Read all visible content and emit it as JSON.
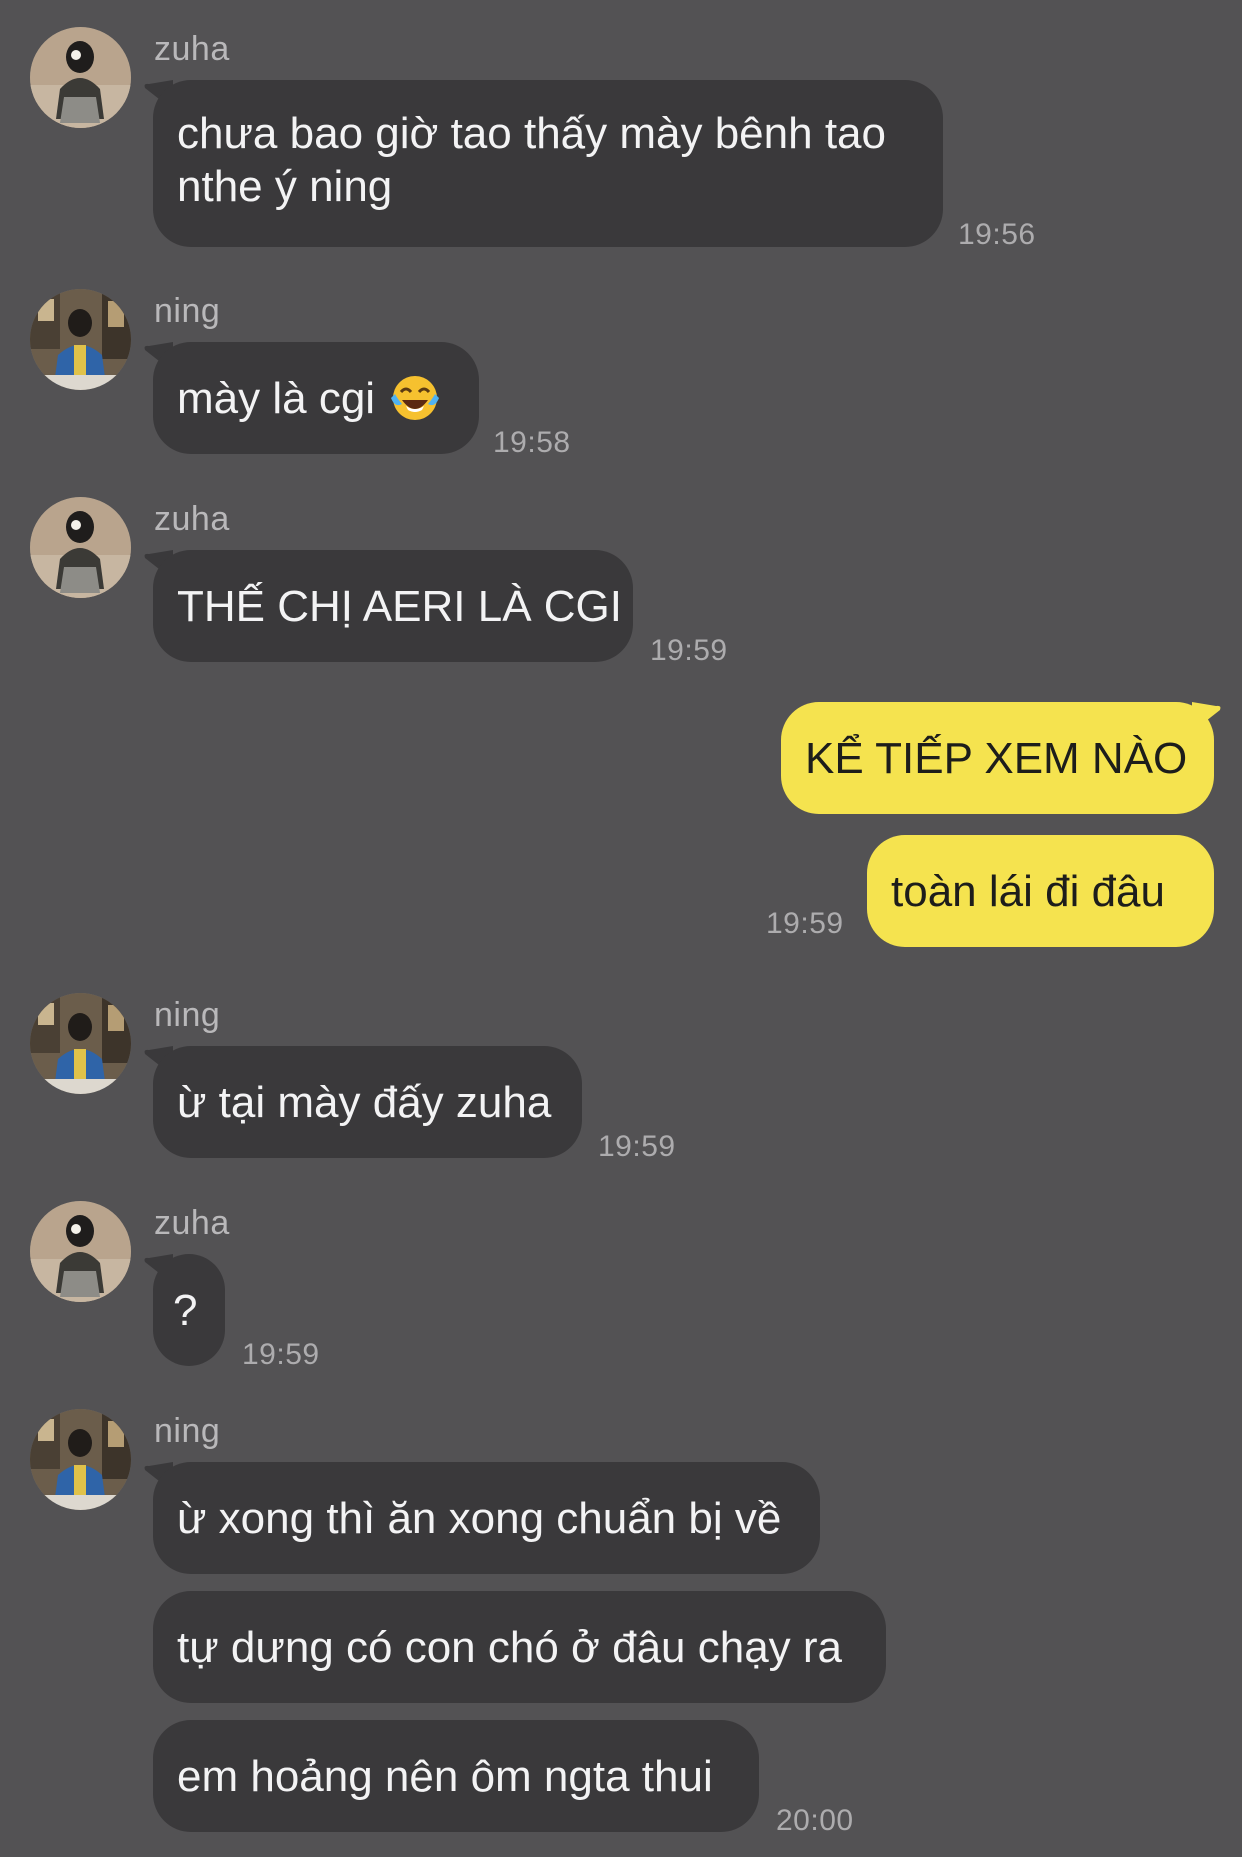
{
  "messages": [
    {
      "sender": "zuha",
      "text": "chưa bao giờ tao thấy mày bênh tao nthe ý ning",
      "time": "19:56"
    },
    {
      "sender": "ning",
      "text": "mày là cgi",
      "emoji": "face-with-tears-of-joy",
      "time": "19:58"
    },
    {
      "sender": "zuha",
      "text": "THẾ CHỊ AERI LÀ CGI",
      "time": "19:59"
    },
    {
      "sender": "me",
      "text": "KỂ TIẾP XEM NÀO"
    },
    {
      "sender": "me",
      "text": "toàn lái đi đâu",
      "time": "19:59"
    },
    {
      "sender": "ning",
      "text": "ừ tại mày đấy zuha",
      "time": "19:59"
    },
    {
      "sender": "zuha",
      "text": "?",
      "time": "19:59"
    },
    {
      "sender": "ning",
      "text": "ừ xong thì ăn xong chuẩn bị về"
    },
    {
      "sender": "ning",
      "text": "tự dưng có con chó ở đâu chạy ra"
    },
    {
      "sender": "ning",
      "text": "em hoảng nên ôm ngta thui",
      "time": "20:00"
    }
  ],
  "colors": {
    "background": "#535254",
    "incoming_bubble": "#3a393b",
    "outgoing_bubble": "#f5e34f"
  }
}
